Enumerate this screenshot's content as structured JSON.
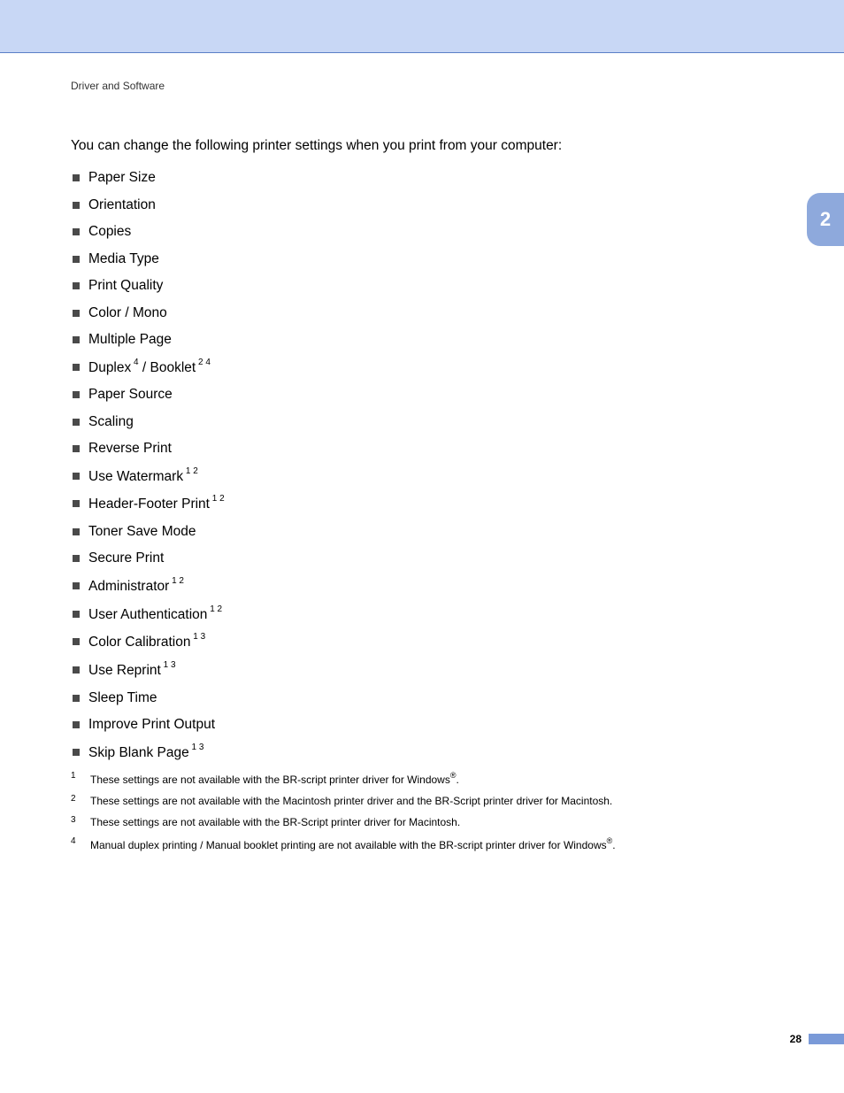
{
  "header": {
    "section": "Driver and Software"
  },
  "intro": "You can change the following printer settings when you print from your computer:",
  "settings": [
    {
      "text": "Paper Size",
      "sup": ""
    },
    {
      "text": "Orientation",
      "sup": ""
    },
    {
      "text": "Copies",
      "sup": ""
    },
    {
      "text": "Media Type",
      "sup": ""
    },
    {
      "text": "Print Quality",
      "sup": ""
    },
    {
      "text": "Color / Mono",
      "sup": ""
    },
    {
      "text": "Multiple Page",
      "sup": ""
    },
    {
      "text": "Duplex",
      "sup": "4",
      "text2": " / Booklet",
      "sup2": "2 4"
    },
    {
      "text": "Paper Source",
      "sup": ""
    },
    {
      "text": "Scaling",
      "sup": ""
    },
    {
      "text": "Reverse Print",
      "sup": ""
    },
    {
      "text": "Use Watermark",
      "sup": "1 2"
    },
    {
      "text": "Header-Footer Print",
      "sup": "1 2"
    },
    {
      "text": "Toner Save Mode",
      "sup": ""
    },
    {
      "text": "Secure Print",
      "sup": ""
    },
    {
      "text": "Administrator",
      "sup": "1 2"
    },
    {
      "text": "User Authentication",
      "sup": "1 2"
    },
    {
      "text": "Color Calibration",
      "sup": "1 3"
    },
    {
      "text": "Use Reprint",
      "sup": "1 3"
    },
    {
      "text": "Sleep Time",
      "sup": ""
    },
    {
      "text": "Improve Print Output",
      "sup": ""
    },
    {
      "text": "Skip Blank Page",
      "sup": "1 3"
    }
  ],
  "footnotes": [
    {
      "num": "1",
      "text": "These settings are not available with the BR-script printer driver for Windows",
      "reg": "®",
      "suffix": "."
    },
    {
      "num": "2",
      "text": "These settings are not available with the Macintosh printer driver and the BR-Script printer driver for Macintosh.",
      "reg": "",
      "suffix": ""
    },
    {
      "num": "3",
      "text": "These settings are not available with the BR-Script printer driver for Macintosh.",
      "reg": "",
      "suffix": ""
    },
    {
      "num": "4",
      "text": "Manual duplex printing / Manual booklet printing are not available with the BR-script printer driver for Windows",
      "reg": "®",
      "suffix": "."
    }
  ],
  "sideTab": "2",
  "pageNumber": "28"
}
